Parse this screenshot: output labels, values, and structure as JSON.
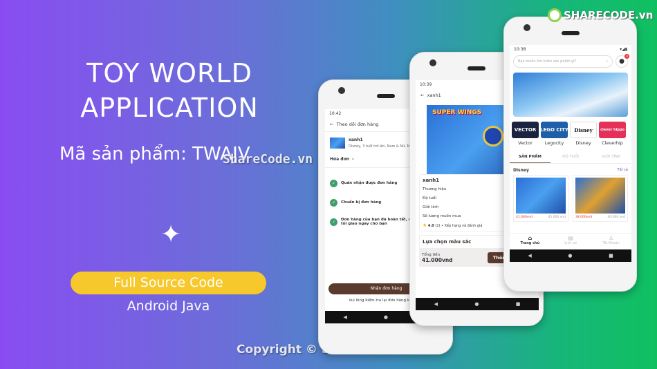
{
  "promo": {
    "title_line1": "TOY WORLD",
    "title_line2": "APPLICATION",
    "product_code": "Mã sản phẩm: TWAJV",
    "watermark_mid": "ShareCode.vn",
    "badge": "Full Source Code",
    "platform": "Android Java",
    "copyright": "Copyright © ShareCode.vn",
    "logo_text": "SHARECODE.vn",
    "colors": {
      "gradient_start": "#8a4cf2",
      "gradient_end": "#10c060",
      "pill": "#f6c82b",
      "accent_brown": "#5b3a2e",
      "step_green": "#3f9e6a"
    }
  },
  "phone1": {
    "time": "10:42",
    "header": "Theo dõi đơn hàng",
    "product_name": "xanh1",
    "product_desc": "Disney, 3 tuổi trở lên, Nam & Nữ, Màu đỏ",
    "invoice": "Hóa đơn",
    "steps": [
      "Quán nhận được đơn hàng",
      "Chuẩn bị đơn hàng",
      "Đơn hàng của bạn đã hoàn tất, chúng tôi giao ngay cho bạn"
    ],
    "receive_button": "Nhận đơn hàng",
    "note": "Vui lòng kiểm tra lại đơn hàng khi nhận"
  },
  "phone2": {
    "time": "10:39",
    "header": "xanh1",
    "product_name": "xanh1",
    "fields": [
      "Thương hiệu",
      "Độ tuổi",
      "Giới tính",
      "Số lượng muốn mua"
    ],
    "rating": "4.0",
    "rating_count": "(2)",
    "rating_label": "Xếp hạng và đánh giá",
    "color_section": "Lựa chọn màu sắc",
    "total_label": "Tổng tiền",
    "total_value": "41.000vnd",
    "add_button": "Thêm vào giỏ",
    "toy_logo": "SUPER WINGS"
  },
  "phone3": {
    "time": "10:38",
    "search_placeholder": "Bạn muốn tìm kiếm sản phẩm gì?",
    "cart_badge": "0",
    "brands": [
      {
        "name": "Vector",
        "logo": "VECTOR"
      },
      {
        "name": "Legocity",
        "logo": "LEGO CITY"
      },
      {
        "name": "Disney",
        "logo": "Disney"
      },
      {
        "name": "Cleverhip",
        "logo": "clever hippo"
      }
    ],
    "tabs": [
      "SẢN PHẨM",
      "ĐỘ TUỔI",
      "GIỚI TÍNH"
    ],
    "section": "Disney",
    "see_all": "Tất cả",
    "products": [
      {
        "price": "41.000vnd",
        "old_price": "45.000 vnd"
      },
      {
        "price": "38.000vnd",
        "old_price": "40.000 vnd"
      }
    ],
    "bottom_nav": [
      "Trang chủ",
      "Lịch sử",
      "Tài Khoản"
    ]
  }
}
